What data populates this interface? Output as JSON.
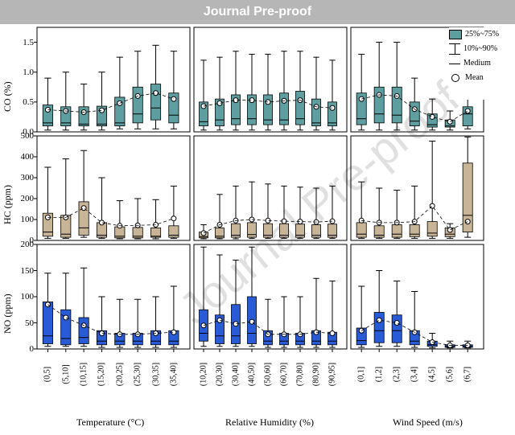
{
  "header": "Journal Pre-proof",
  "legend": {
    "box": "25%~75%",
    "whisk": "10%~90%",
    "line": "Medium",
    "circle": "Mean"
  },
  "axis_labels": {
    "y": [
      "CO (%)",
      "HC (ppm)",
      "NO (ppm)"
    ],
    "x": [
      "Temperature (°C)",
      "Relative Humidity (%)",
      "Wind Speed (m/s)"
    ]
  },
  "watermark": "Journal Pre-proof",
  "categories": {
    "temp": [
      "(0,5]",
      "(5,10]",
      "(10,15]",
      "(15,20]",
      "(20,25]",
      "(25,30]",
      "(30,35]",
      "(35,40]"
    ],
    "rh": [
      "(10,20]",
      "(20,30]",
      "(30,40]",
      "(40,50]",
      "(50,60]",
      "(60,70]",
      "(70,80]",
      "(80,90]",
      "(90,95]"
    ],
    "ws": [
      "(0,1]",
      "(1,2]",
      "(2,3]",
      "(3,4]",
      "(4,5]",
      "(5,6]",
      "(6,7]"
    ]
  },
  "chart_data": {
    "type": "boxplot_grid",
    "rows": [
      "CO",
      "HC",
      "NO"
    ],
    "cols": [
      "Temperature",
      "Relative Humidity",
      "Wind Speed"
    ],
    "ylim": {
      "CO": [
        0,
        1.75
      ],
      "HC": [
        0,
        500
      ],
      "NO": [
        0,
        200
      ]
    },
    "yticks": {
      "CO": [
        0.0,
        0.5,
        1.0,
        1.5
      ],
      "HC": [
        0,
        100,
        200,
        300,
        400,
        500
      ],
      "NO": [
        0,
        50,
        100,
        150,
        200
      ]
    },
    "colors": {
      "CO": "#5f9ea0",
      "HC": "#c8b496",
      "NO": "#2a5bd7"
    },
    "panels": {
      "CO_temp": [
        {
          "w10": 0.03,
          "q25": 0.1,
          "med": 0.15,
          "q75": 0.45,
          "w90": 0.9,
          "mean": 0.37
        },
        {
          "w10": 0.03,
          "q25": 0.1,
          "med": 0.15,
          "q75": 0.42,
          "w90": 1.0,
          "mean": 0.35
        },
        {
          "w10": 0.03,
          "q25": 0.1,
          "med": 0.13,
          "q75": 0.42,
          "w90": 0.8,
          "mean": 0.33
        },
        {
          "w10": 0.03,
          "q25": 0.1,
          "med": 0.13,
          "q75": 0.43,
          "w90": 1.0,
          "mean": 0.36
        },
        {
          "w10": 0.05,
          "q25": 0.1,
          "med": 0.15,
          "q75": 0.58,
          "w90": 1.25,
          "mean": 0.48
        },
        {
          "w10": 0.05,
          "q25": 0.15,
          "med": 0.3,
          "q75": 0.75,
          "w90": 1.35,
          "mean": 0.6
        },
        {
          "w10": 0.05,
          "q25": 0.2,
          "med": 0.4,
          "q75": 0.8,
          "w90": 1.45,
          "mean": 0.65
        },
        {
          "w10": 0.05,
          "q25": 0.15,
          "med": 0.28,
          "q75": 0.65,
          "w90": 1.35,
          "mean": 0.55
        }
      ],
      "CO_rh": [
        {
          "w10": 0.03,
          "q25": 0.1,
          "med": 0.17,
          "q75": 0.5,
          "w90": 1.2,
          "mean": 0.43
        },
        {
          "w10": 0.03,
          "q25": 0.1,
          "med": 0.2,
          "q75": 0.55,
          "w90": 1.25,
          "mean": 0.48
        },
        {
          "w10": 0.03,
          "q25": 0.12,
          "med": 0.22,
          "q75": 0.62,
          "w90": 1.35,
          "mean": 0.53
        },
        {
          "w10": 0.03,
          "q25": 0.12,
          "med": 0.22,
          "q75": 0.62,
          "w90": 1.3,
          "mean": 0.53
        },
        {
          "w10": 0.03,
          "q25": 0.12,
          "med": 0.2,
          "q75": 0.62,
          "w90": 1.3,
          "mean": 0.5
        },
        {
          "w10": 0.03,
          "q25": 0.12,
          "med": 0.2,
          "q75": 0.65,
          "w90": 1.35,
          "mean": 0.52
        },
        {
          "w10": 0.03,
          "q25": 0.12,
          "med": 0.22,
          "q75": 0.68,
          "w90": 1.35,
          "mean": 0.53
        },
        {
          "w10": 0.03,
          "q25": 0.1,
          "med": 0.15,
          "q75": 0.55,
          "w90": 1.25,
          "mean": 0.42
        },
        {
          "w10": 0.03,
          "q25": 0.1,
          "med": 0.15,
          "q75": 0.5,
          "w90": 1.2,
          "mean": 0.4
        }
      ],
      "CO_ws": [
        {
          "w10": 0.03,
          "q25": 0.12,
          "med": 0.22,
          "q75": 0.65,
          "w90": 1.3,
          "mean": 0.55
        },
        {
          "w10": 0.03,
          "q25": 0.15,
          "med": 0.3,
          "q75": 0.75,
          "w90": 1.5,
          "mean": 0.62
        },
        {
          "w10": 0.03,
          "q25": 0.15,
          "med": 0.28,
          "q75": 0.75,
          "w90": 1.5,
          "mean": 0.6
        },
        {
          "w10": 0.03,
          "q25": 0.1,
          "med": 0.18,
          "q75": 0.5,
          "w90": 0.9,
          "mean": 0.38
        },
        {
          "w10": 0.03,
          "q25": 0.08,
          "med": 0.12,
          "q75": 0.3,
          "w90": 0.55,
          "mean": 0.25
        },
        {
          "w10": 0.03,
          "q25": 0.08,
          "med": 0.1,
          "q75": 0.2,
          "w90": 0.35,
          "mean": 0.17
        },
        {
          "w10": 0.05,
          "q25": 0.1,
          "med": 0.3,
          "q75": 0.42,
          "w90": 0.55,
          "mean": 0.35
        }
      ],
      "HC_temp": [
        {
          "w10": 10,
          "q25": 20,
          "med": 40,
          "q75": 130,
          "w90": 350,
          "mean": 110
        },
        {
          "w10": 10,
          "q25": 15,
          "med": 30,
          "q75": 120,
          "w90": 390,
          "mean": 110
        },
        {
          "w10": 15,
          "q25": 25,
          "med": 60,
          "q75": 185,
          "w90": 430,
          "mean": 155
        },
        {
          "w10": 10,
          "q25": 15,
          "med": 25,
          "q75": 85,
          "w90": 300,
          "mean": 85
        },
        {
          "w10": 8,
          "q25": 12,
          "med": 20,
          "q75": 65,
          "w90": 190,
          "mean": 70
        },
        {
          "w10": 8,
          "q25": 12,
          "med": 20,
          "q75": 62,
          "w90": 200,
          "mean": 72
        },
        {
          "w10": 8,
          "q25": 15,
          "med": 20,
          "q75": 60,
          "w90": 195,
          "mean": 75
        },
        {
          "w10": 10,
          "q25": 15,
          "med": 25,
          "q75": 70,
          "w90": 260,
          "mean": 105
        }
      ],
      "HC_rh": [
        {
          "w10": 8,
          "q25": 12,
          "med": 18,
          "q75": 40,
          "w90": 75,
          "mean": 35
        },
        {
          "w10": 8,
          "q25": 12,
          "med": 20,
          "q75": 60,
          "w90": 220,
          "mean": 75
        },
        {
          "w10": 8,
          "q25": 15,
          "med": 25,
          "q75": 80,
          "w90": 260,
          "mean": 95
        },
        {
          "w10": 10,
          "q25": 15,
          "med": 28,
          "q75": 85,
          "w90": 280,
          "mean": 100
        },
        {
          "w10": 10,
          "q25": 15,
          "med": 25,
          "q75": 80,
          "w90": 270,
          "mean": 95
        },
        {
          "w10": 10,
          "q25": 15,
          "med": 25,
          "q75": 80,
          "w90": 260,
          "mean": 92
        },
        {
          "w10": 10,
          "q25": 15,
          "med": 25,
          "q75": 78,
          "w90": 255,
          "mean": 90
        },
        {
          "w10": 10,
          "q25": 15,
          "med": 25,
          "q75": 75,
          "w90": 250,
          "mean": 88
        },
        {
          "w10": 10,
          "q25": 15,
          "med": 25,
          "q75": 78,
          "w90": 260,
          "mean": 92
        }
      ],
      "HC_ws": [
        {
          "w10": 10,
          "q25": 15,
          "med": 30,
          "q75": 85,
          "w90": 280,
          "mean": 95
        },
        {
          "w10": 10,
          "q25": 15,
          "med": 25,
          "q75": 70,
          "w90": 250,
          "mean": 85
        },
        {
          "w10": 10,
          "q25": 15,
          "med": 30,
          "q75": 75,
          "w90": 240,
          "mean": 85
        },
        {
          "w10": 10,
          "q25": 18,
          "med": 30,
          "q75": 75,
          "w90": 260,
          "mean": 90
        },
        {
          "w10": 10,
          "q25": 20,
          "med": 35,
          "q75": 90,
          "w90": 475,
          "mean": 165
        },
        {
          "w10": 10,
          "q25": 18,
          "med": 30,
          "q75": 60,
          "w90": 80,
          "mean": 50
        },
        {
          "w10": 15,
          "q25": 40,
          "med": 120,
          "q75": 370,
          "w90": 495,
          "mean": 90
        }
      ],
      "NO_temp": [
        {
          "w10": 5,
          "q25": 10,
          "med": 25,
          "q75": 90,
          "w90": 145,
          "mean": 85
        },
        {
          "w10": 5,
          "q25": 8,
          "med": 20,
          "q75": 75,
          "w90": 145,
          "mean": 60
        },
        {
          "w10": 5,
          "q25": 10,
          "med": 22,
          "q75": 60,
          "w90": 155,
          "mean": 45
        },
        {
          "w10": 3,
          "q25": 8,
          "med": 15,
          "q75": 35,
          "w90": 100,
          "mean": 30
        },
        {
          "w10": 3,
          "q25": 8,
          "med": 15,
          "q75": 30,
          "w90": 95,
          "mean": 28
        },
        {
          "w10": 3,
          "q25": 8,
          "med": 15,
          "q75": 30,
          "w90": 95,
          "mean": 28
        },
        {
          "w10": 3,
          "q25": 8,
          "med": 15,
          "q75": 35,
          "w90": 100,
          "mean": 30
        },
        {
          "w10": 3,
          "q25": 8,
          "med": 15,
          "q75": 35,
          "w90": 120,
          "mean": 32
        }
      ],
      "NO_rh": [
        {
          "w10": 5,
          "q25": 15,
          "med": 30,
          "q75": 75,
          "w90": 195,
          "mean": 45
        },
        {
          "w10": 5,
          "q25": 10,
          "med": 25,
          "q75": 65,
          "w90": 180,
          "mean": 55
        },
        {
          "w10": 5,
          "q25": 10,
          "med": 25,
          "q75": 85,
          "w90": 170,
          "mean": 48
        },
        {
          "w10": 5,
          "q25": 10,
          "med": 30,
          "q75": 100,
          "w90": 195,
          "mean": 52
        },
        {
          "w10": 3,
          "q25": 8,
          "med": 15,
          "q75": 35,
          "w90": 95,
          "mean": 28
        },
        {
          "w10": 3,
          "q25": 8,
          "med": 15,
          "q75": 30,
          "w90": 100,
          "mean": 28
        },
        {
          "w10": 3,
          "q25": 8,
          "med": 15,
          "q75": 30,
          "w90": 100,
          "mean": 28
        },
        {
          "w10": 3,
          "q25": 8,
          "med": 15,
          "q75": 35,
          "w90": 135,
          "mean": 32
        },
        {
          "w10": 3,
          "q25": 8,
          "med": 15,
          "q75": 32,
          "w90": 130,
          "mean": 30
        }
      ],
      "NO_ws": [
        {
          "w10": 3,
          "q25": 8,
          "med": 16,
          "q75": 40,
          "w90": 120,
          "mean": 35
        },
        {
          "w10": 5,
          "q25": 12,
          "med": 35,
          "q75": 70,
          "w90": 150,
          "mean": 55
        },
        {
          "w10": 5,
          "q25": 12,
          "med": 35,
          "q75": 65,
          "w90": 130,
          "mean": 50
        },
        {
          "w10": 3,
          "q25": 8,
          "med": 15,
          "q75": 35,
          "w90": 110,
          "mean": 32
        },
        {
          "w10": 2,
          "q25": 5,
          "med": 8,
          "q75": 15,
          "w90": 30,
          "mean": 13
        },
        {
          "w10": 2,
          "q25": 3,
          "med": 5,
          "q75": 8,
          "w90": 15,
          "mean": 7
        },
        {
          "w10": 2,
          "q25": 3,
          "med": 5,
          "q75": 8,
          "w90": 15,
          "mean": 7
        }
      ]
    }
  }
}
